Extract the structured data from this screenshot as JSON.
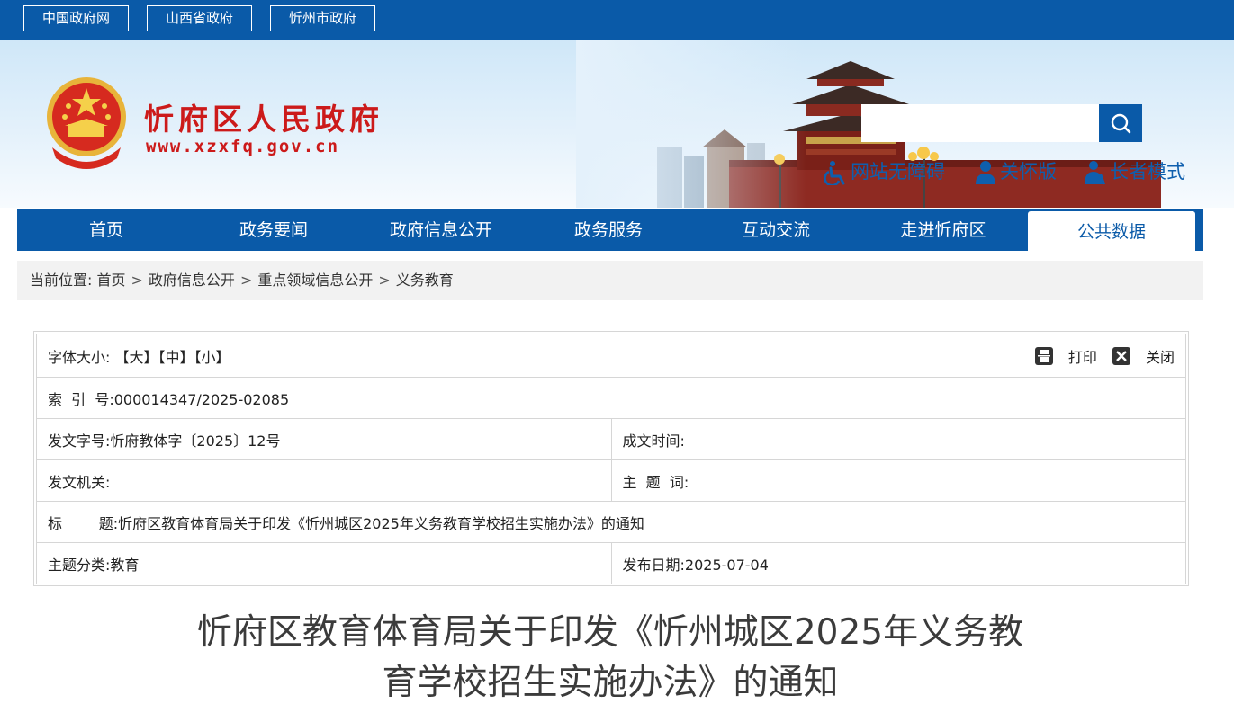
{
  "top_links": [
    "中国政府网",
    "山西省政府",
    "忻州市政府"
  ],
  "header": {
    "site_name": "忻府区人民政府",
    "domain": "www.xzxfq.gov.cn"
  },
  "search": {
    "placeholder": ""
  },
  "tools": {
    "accessibility": "网站无障碍",
    "care": "关怀版",
    "elder": "长者模式"
  },
  "nav": {
    "items": [
      "首页",
      "政务要闻",
      "政府信息公开",
      "政务服务",
      "互动交流",
      "走进忻府区",
      "公共数据"
    ],
    "active_index": 6
  },
  "breadcrumb": {
    "label": "当前位置:",
    "items": [
      "首页",
      "政府信息公开",
      "重点领域信息公开",
      "义务教育"
    ],
    "separator": ">"
  },
  "meta": {
    "font_size_label": "字体大小:",
    "font_large": "【大】",
    "font_medium": "【中】",
    "font_small": "【小】",
    "print_label": "打印",
    "close_label": "关闭",
    "index_label": "索  引  号:",
    "index_value": "000014347/2025-02085",
    "doc_number_label": "发文字号:",
    "doc_number_value": "忻府教体字〔2025〕12号",
    "created_label": "成文时间:",
    "created_value": "",
    "issuer_label": "发文机关:",
    "issuer_value": "",
    "keywords_label": "主  题  词:",
    "keywords_value": "",
    "title_label": "标        题:",
    "title_value": "忻府区教育体育局关于印发《忻州城区2025年义务教育学校招生实施办法》的通知",
    "category_label": "主题分类:",
    "category_value": "教育",
    "publish_label": "发布日期:",
    "publish_value": "2025-07-04"
  },
  "document": {
    "title_line1": "忻府区教育体育局关于印发《忻州城区2025年义务教",
    "title_line2": "育学校招生实施办法》的通知"
  },
  "colors": {
    "primary": "#0a5aa8",
    "brand_red": "#cc1a1a",
    "breadcrumb_bg": "#f2f2f2"
  }
}
